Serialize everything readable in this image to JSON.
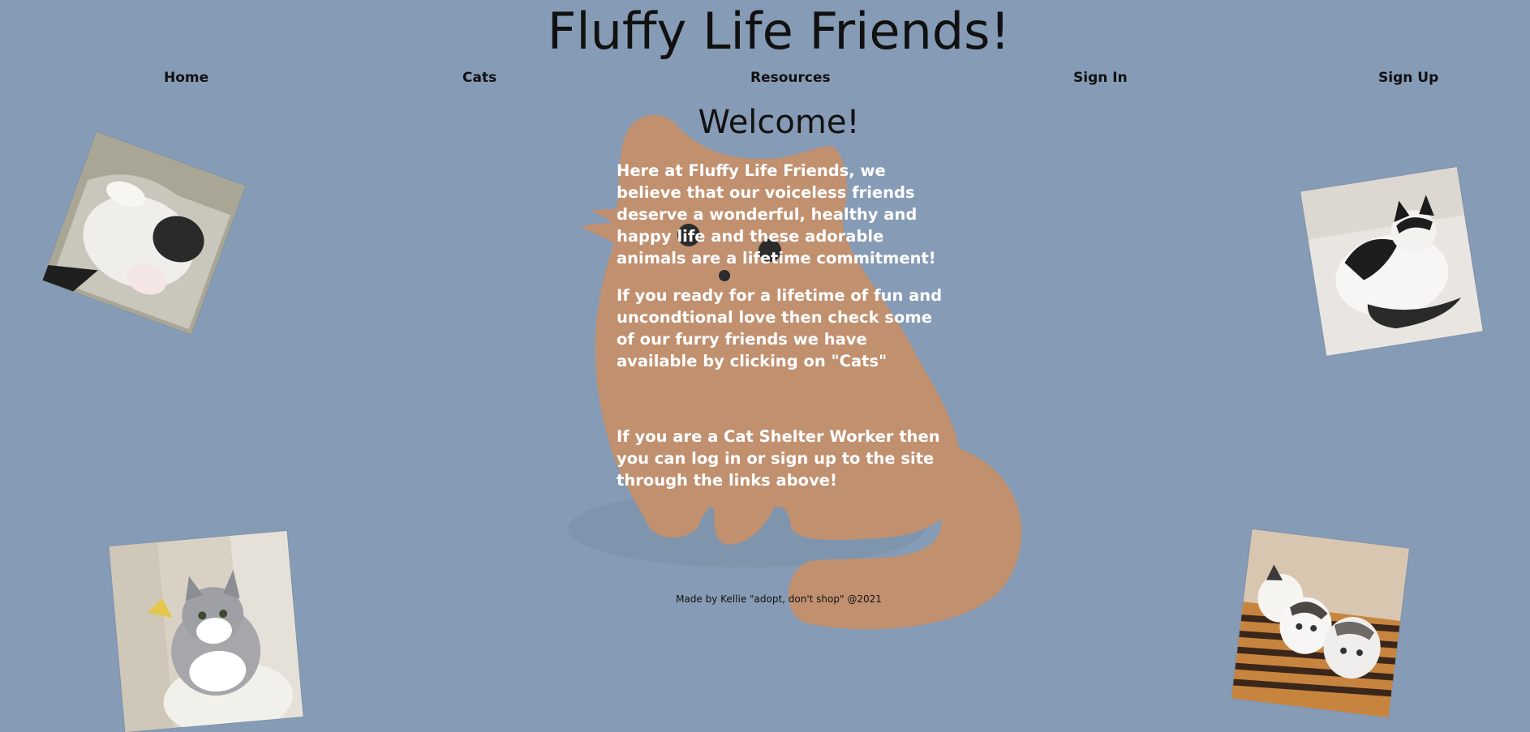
{
  "site": {
    "title": "Fluffy Life Friends!"
  },
  "nav": {
    "home": "Home",
    "cats": "Cats",
    "resources": "Resources",
    "sign_in": "Sign In",
    "sign_up": "Sign Up"
  },
  "main": {
    "heading": "Welcome!",
    "paragraphs": [
      "Here at Fluffy Life Friends, we believe that our voiceless friends deserve a wonderful, healthy and happy life and these adorable animals are a lifetime commitment!",
      "If you ready for a lifetime of fun and uncondtional love then check some of our furry friends we have available by clicking on \"Cats\"",
      "If you are a Cat Shelter Worker then you can log in or sign up to the site through the links above!"
    ]
  },
  "footer": {
    "text": "Made by Kellie \"adopt, don't shop\" @2021"
  },
  "colors": {
    "background": "#869bb5",
    "cat_silhouette": "#c1906f",
    "body_text": "#ffffff"
  },
  "icons": {
    "cat_silhouette": "cat-silhouette-icon"
  }
}
